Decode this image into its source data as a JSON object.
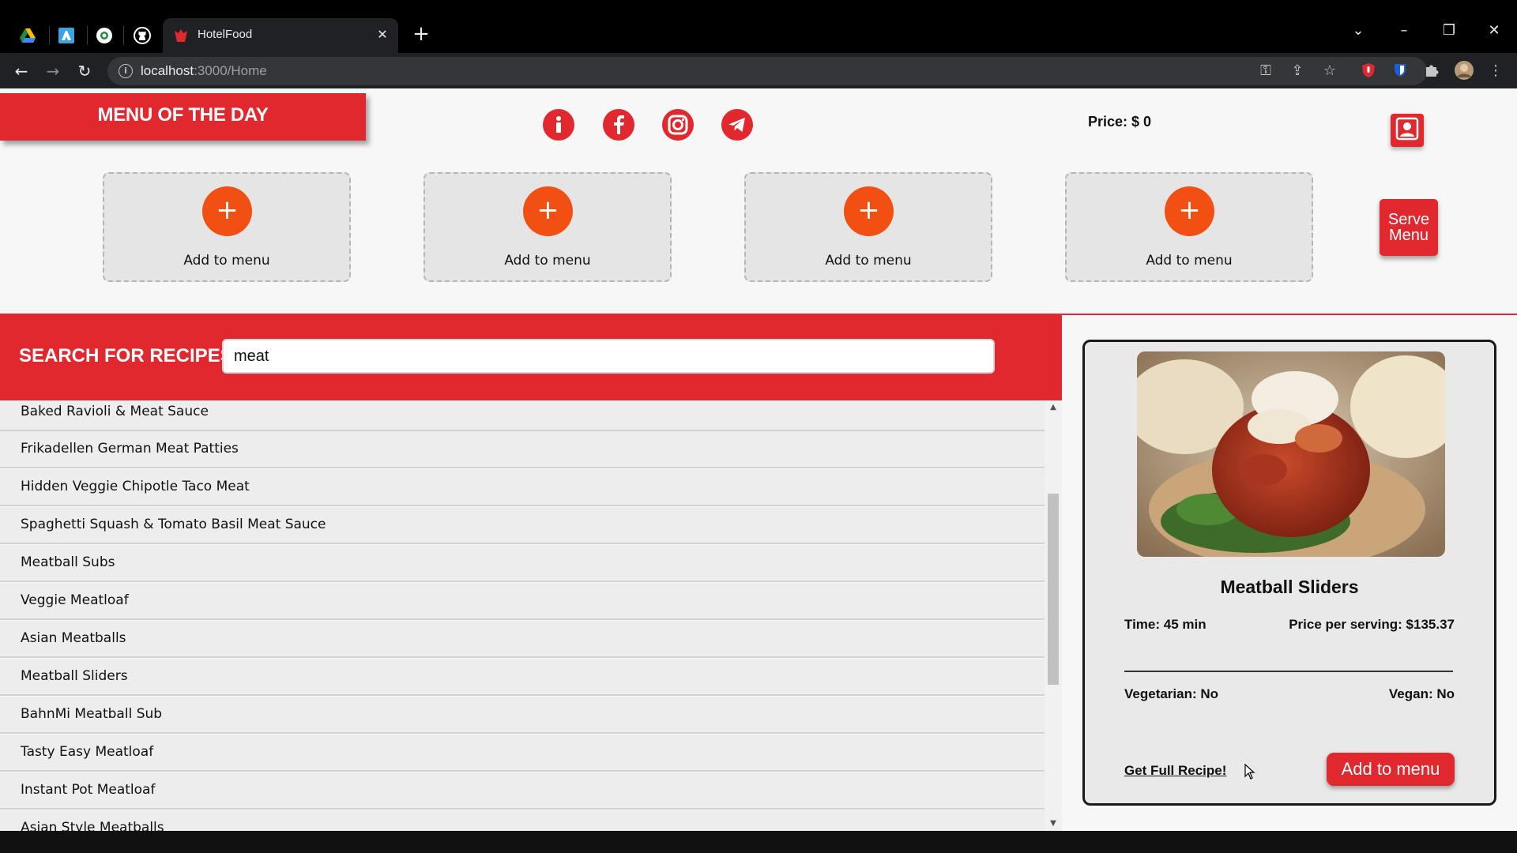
{
  "browser": {
    "pinned_tabs": [
      "google-drive-icon",
      "azure-icon",
      "chrome-web-icon",
      "github-icon"
    ],
    "active_tab": {
      "title": "HotelFood",
      "favicon": "hotelfood-logo-icon"
    },
    "url": {
      "host": "localhost",
      "path": ":3000/Home"
    }
  },
  "header": {
    "banner": "MENU OF THE DAY",
    "social_icons": [
      "info-icon",
      "facebook-icon",
      "instagram-icon",
      "telegram-icon"
    ],
    "price_label": "Price: $ 0",
    "profile_icon": "user-icon"
  },
  "menu_slots": [
    {
      "label": "Add to menu"
    },
    {
      "label": "Add to menu"
    },
    {
      "label": "Add to menu"
    },
    {
      "label": "Add to menu"
    }
  ],
  "serve_button": "Serve Menu",
  "search": {
    "label": "SEARCH FOR RECIPES",
    "value": "meat"
  },
  "results": [
    "Baked Ravioli & Meat Sauce",
    "Frikadellen German Meat Patties",
    "Hidden Veggie Chipotle Taco Meat",
    "Spaghetti Squash & Tomato Basil Meat Sauce",
    "Meatball Subs",
    "Veggie Meatloaf",
    "Asian Meatballs",
    "Meatball Sliders",
    "BahnMi Meatball Sub",
    "Tasty Easy Meatloaf",
    "Instant Pot Meatloaf",
    "Asian Style Meatballs"
  ],
  "detail": {
    "name": "Meatball Sliders",
    "time": "Time: 45 min",
    "price": "Price per serving: $135.37",
    "vegetarian": "Vegetarian: No",
    "vegan": "Vegan: No",
    "recipe_link": "Get Full Recipe!",
    "add_button": "Add to menu"
  },
  "colors": {
    "brand_red": "#e0282e",
    "accent_orange": "#f24f12"
  }
}
